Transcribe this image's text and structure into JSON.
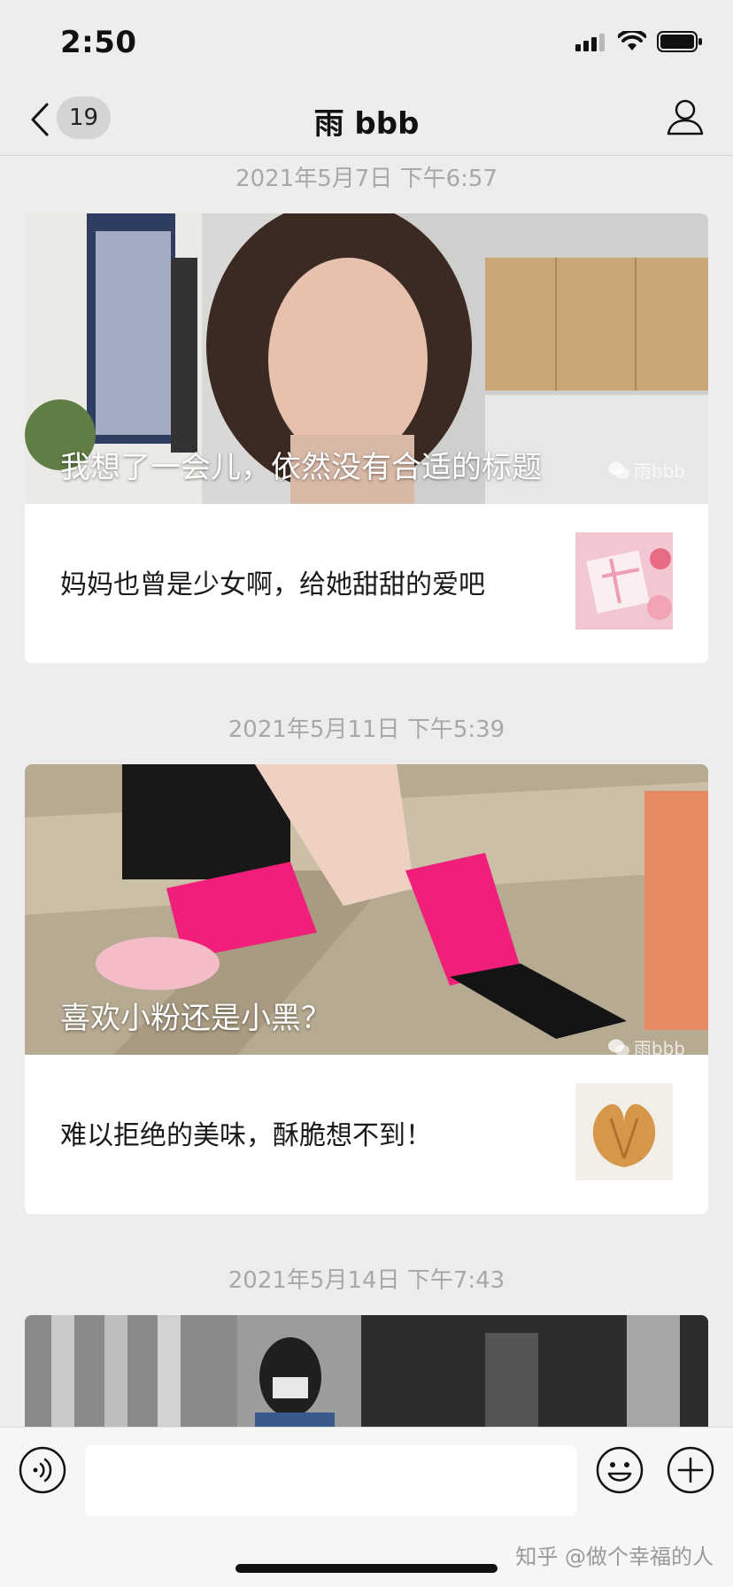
{
  "status_bar": {
    "time": "2:50"
  },
  "nav": {
    "unread_count": "19",
    "title": "雨 bbb"
  },
  "posts": [
    {
      "timestamp": "2021年5月7日 下午6:57",
      "hero_title": "我想了一会儿，依然没有合适的标题",
      "watermark": "雨bbb",
      "sub_title": "妈妈也曾是少女啊，给她甜甜的爱吧"
    },
    {
      "timestamp": "2021年5月11日 下午5:39",
      "hero_title": "喜欢小粉还是小黑？",
      "watermark": "雨bbb",
      "sub_title": "难以拒绝的美味，酥脆想不到！"
    },
    {
      "timestamp": "2021年5月14日 下午7:43"
    }
  ],
  "input": {
    "value": ""
  },
  "footer": {
    "zhihu_watermark": "知乎 @做个幸福的人"
  },
  "colors": {
    "background": "#ededed",
    "card": "#ffffff",
    "timestamp": "#a8a8a8"
  }
}
